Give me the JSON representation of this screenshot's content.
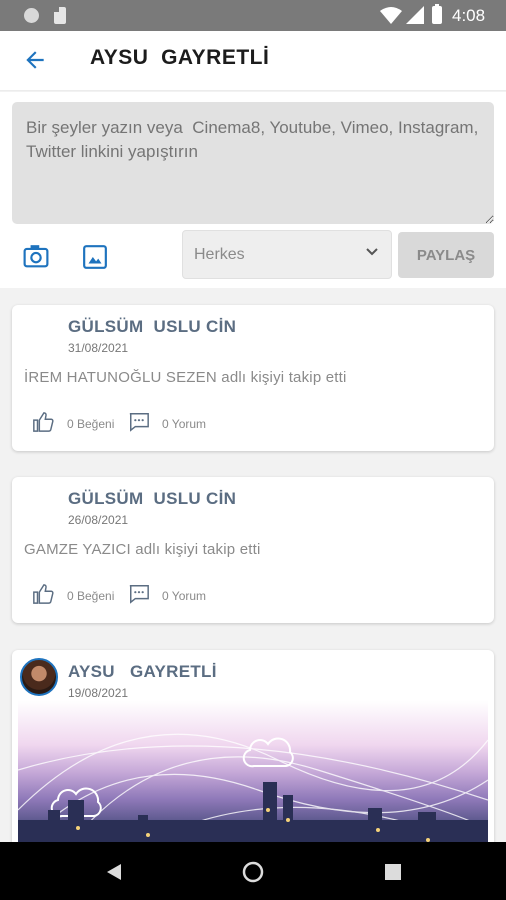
{
  "status_bar": {
    "time": "4:08"
  },
  "app_bar": {
    "title": "AYSU  GAYRETLİ"
  },
  "composer": {
    "placeholder": "Bir şeyler yazın veya  Cinema8, Youtube, Vimeo, Instagram, Twitter linkini yapıştırın",
    "audience": "Herkes",
    "share_label": "PAYLAŞ"
  },
  "posts": [
    {
      "author": "GÜLSÜM  USLU CİN",
      "date": "31/08/2021",
      "text": "İREM HATUNOĞLU SEZEN adlı kişiyi takip etti",
      "likes": "0 Beğeni",
      "comments": "0 Yorum"
    },
    {
      "author": "GÜLSÜM  USLU CİN",
      "date": "26/08/2021",
      "text": "GAMZE YAZICI adlı kişiyi takip etti",
      "likes": "0 Beğeni",
      "comments": "0 Yorum"
    },
    {
      "author": "AYSU   GAYRETLİ",
      "date": "19/08/2021"
    }
  ],
  "icons": {
    "back": "arrow-left-icon",
    "camera": "camera-icon",
    "gallery": "image-icon",
    "like": "thumbs-up-icon",
    "comment": "comment-icon"
  },
  "colors": {
    "accent": "#1e73be",
    "author": "#5b6d82"
  }
}
